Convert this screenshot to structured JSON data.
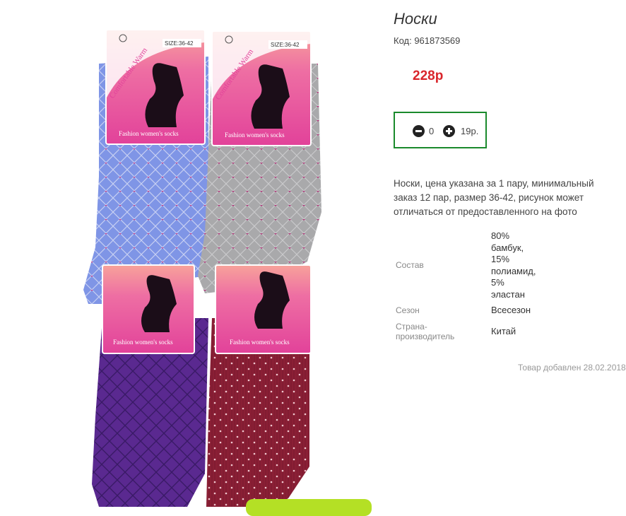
{
  "product": {
    "title": "Носки",
    "code": "Код: 961873569",
    "price": "228р",
    "quantity": "0",
    "unit_price": "19р.",
    "description": "Носки, цена указана за 1 пару, минимальный заказ 12 пар, размер 36-42, рисунок может отличаться от предоставленного на фото",
    "attributes": {
      "composition": {
        "label": "Состав",
        "lines": [
          "80%",
          "бамбук,",
          "15%",
          "полиамид,",
          "5%",
          "эластан"
        ]
      },
      "season": {
        "label": "Сезон",
        "value": "Всесезон"
      },
      "country": {
        "label_lines": [
          "Страна-",
          "производитель"
        ],
        "value": "Китай"
      }
    },
    "added": "Товар добавлен 28.02.2018"
  },
  "packaging": {
    "brand": "Comfortable Warm",
    "size": "SIZE:36-42",
    "tagline": "Fashion women's socks"
  },
  "colors": {
    "accent_red": "#d9262c",
    "qty_border": "#1a8a2c",
    "button_green": "#b4e025"
  }
}
